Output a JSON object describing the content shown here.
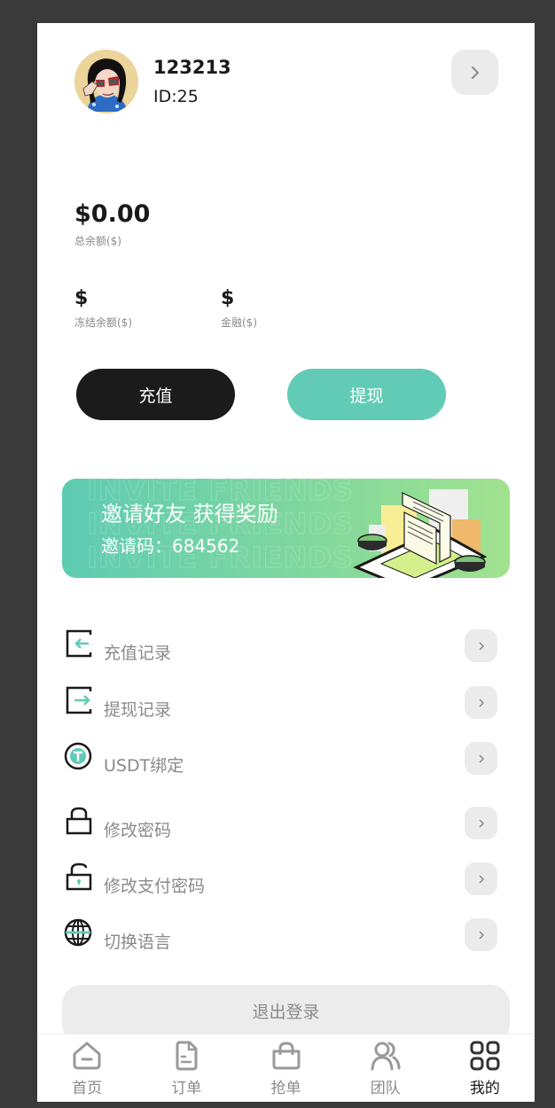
{
  "colors": {
    "accent": "#61cbb5",
    "dark_button": "#1b1b1b",
    "muted_text": "#8a8a8a",
    "arrow_bg": "#ebebeb",
    "background_frame": "#3a3a3a"
  },
  "user": {
    "name": "123213",
    "id_label": "ID:25",
    "avatar_icon": "avatar-illustration"
  },
  "balances": {
    "total_amount": "$0.00",
    "total_label": "总余额($)",
    "frozen_amount": "$",
    "frozen_label": "冻结余额($)",
    "finance_amount": "$",
    "finance_label": "金融($)"
  },
  "actions": {
    "recharge_label": "充值",
    "withdraw_label": "提现"
  },
  "banner": {
    "title": "邀请好友 获得奖励",
    "code_text": "邀请码：684562",
    "watermark": "INVITE FRIENDS"
  },
  "menu": {
    "items": [
      {
        "label": "充值记录",
        "icon": "recharge-record-icon"
      },
      {
        "label": "提现记录",
        "icon": "withdraw-record-icon"
      },
      {
        "label": "USDT绑定",
        "icon": "usdt-icon"
      },
      {
        "label": "修改密码",
        "icon": "lock-icon"
      },
      {
        "label": "修改支付密码",
        "icon": "unlock-icon"
      },
      {
        "label": "切换语言",
        "icon": "globe-icon"
      }
    ]
  },
  "logout_label": "退出登录",
  "tabbar": {
    "items": [
      {
        "label": "首页",
        "icon": "home-icon",
        "active": false
      },
      {
        "label": "订单",
        "icon": "document-icon",
        "active": false
      },
      {
        "label": "抢单",
        "icon": "shopping-bag-icon",
        "active": false
      },
      {
        "label": "团队",
        "icon": "team-icon",
        "active": false
      },
      {
        "label": "我的",
        "icon": "grid-icon",
        "active": true
      }
    ]
  }
}
